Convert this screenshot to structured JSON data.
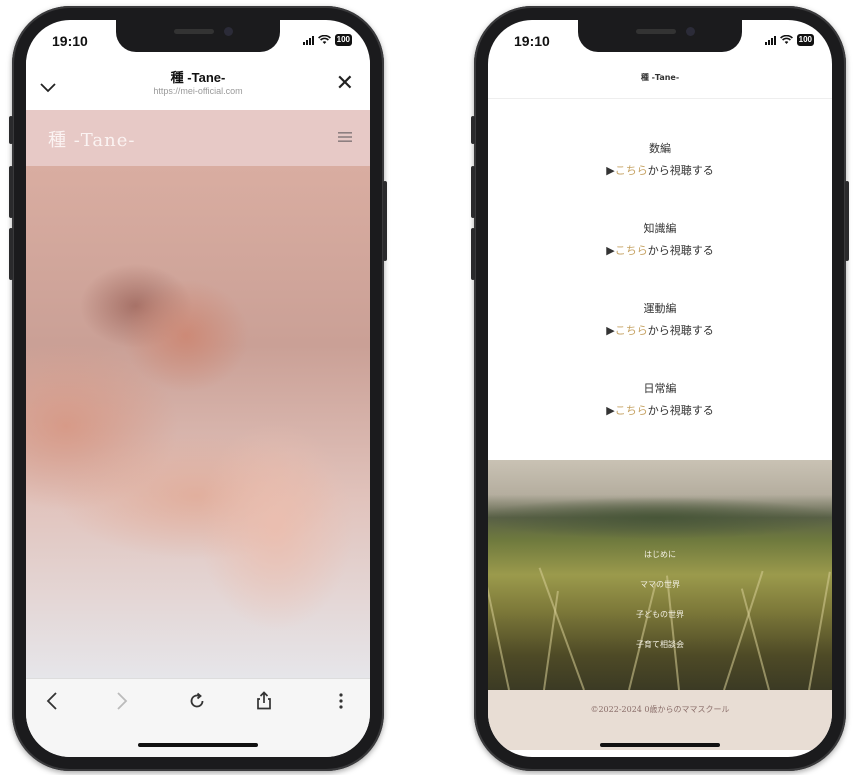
{
  "left_phone": {
    "status": {
      "time": "19:10",
      "battery": "100"
    },
    "browser": {
      "title": "種 -Tane-",
      "url": "https://mei-official.com",
      "close_glyph": "✕",
      "collapse_icon": "chevron-down-icon"
    },
    "site": {
      "logo": "種 -Tane-",
      "menu_icon": "hamburger-icon"
    },
    "hero_image": "baby-hand-holding-finger",
    "nav": {
      "back_icon": "chevron-left-icon",
      "forward_icon": "chevron-right-icon",
      "reload_icon": "reload-icon",
      "share_icon": "share-icon",
      "more_icon": "more-vertical-icon"
    }
  },
  "right_phone": {
    "status": {
      "time": "19:10",
      "battery": "100"
    },
    "page_title": "種 -Tane-",
    "sections": [
      {
        "heading": "数編",
        "link_prefix": "▶",
        "link_accent": "こちら",
        "link_rest": "から視聴する"
      },
      {
        "heading": "知識編",
        "link_prefix": "▶",
        "link_accent": "こちら",
        "link_rest": "から視聴する"
      },
      {
        "heading": "運動編",
        "link_prefix": "▶",
        "link_accent": "こちら",
        "link_rest": "から視聴する"
      },
      {
        "heading": "日常編",
        "link_prefix": "▶",
        "link_accent": "こちら",
        "link_rest": "から視聴する"
      }
    ],
    "footer_links": [
      "はじめに",
      "ママの世界",
      "子どもの世界",
      "子育て相談会"
    ],
    "copyright": "©2022-2024 0歳からのママスクール",
    "background_image": "grass-field"
  },
  "colors": {
    "header_pink": "#e7c9c6",
    "accent_gold": "#c5a262",
    "footer_beige": "#e8ddd4"
  }
}
